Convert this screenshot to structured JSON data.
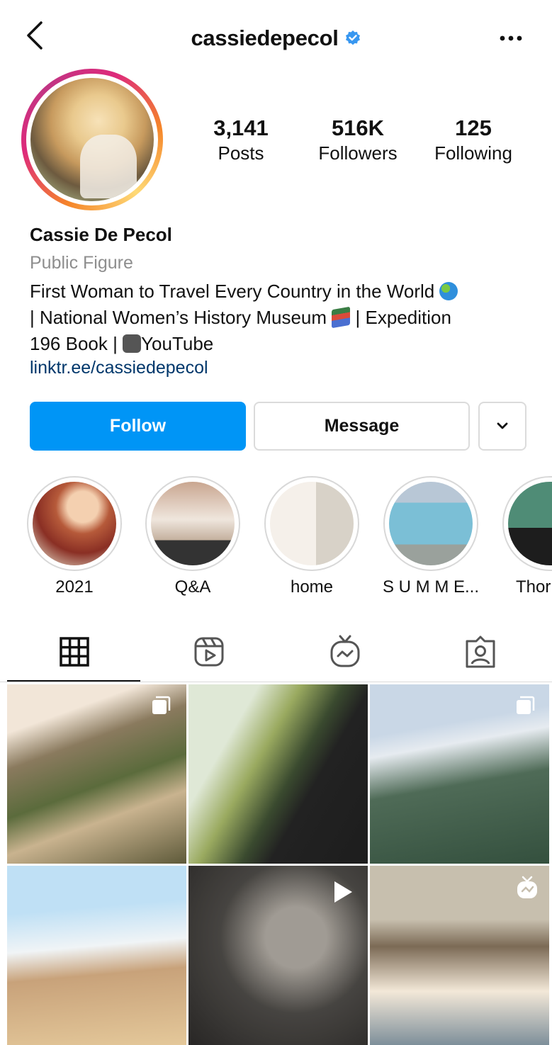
{
  "header": {
    "username": "cassiedepecol"
  },
  "stats": [
    {
      "value": "3,141",
      "label": "Posts"
    },
    {
      "value": "516K",
      "label": "Followers"
    },
    {
      "value": "125",
      "label": "Following"
    }
  ],
  "profile": {
    "name": "Cassie De Pecol",
    "category": "Public Figure",
    "bio_line1": "First Woman to Travel Every Country in the World",
    "bio_line2": "| National Women’s History Museum",
    "bio_line2b": "| Expedition",
    "bio_line3a": "196 Book |",
    "bio_line3b": "YouTube",
    "link": "linktr.ee/cassiedepecol"
  },
  "buttons": {
    "follow": "Follow",
    "message": "Message"
  },
  "highlights": [
    {
      "label": "2021"
    },
    {
      "label": "Q&A"
    },
    {
      "label": "home"
    },
    {
      "label": "S U M M E..."
    },
    {
      "label": "Thor"
    }
  ],
  "tabs": [
    "grid",
    "reels",
    "igtv",
    "tagged"
  ],
  "colors": {
    "follow_blue": "#0095f6",
    "link": "#00376b",
    "muted": "#8e8e8e",
    "verified": "#3897f0"
  }
}
